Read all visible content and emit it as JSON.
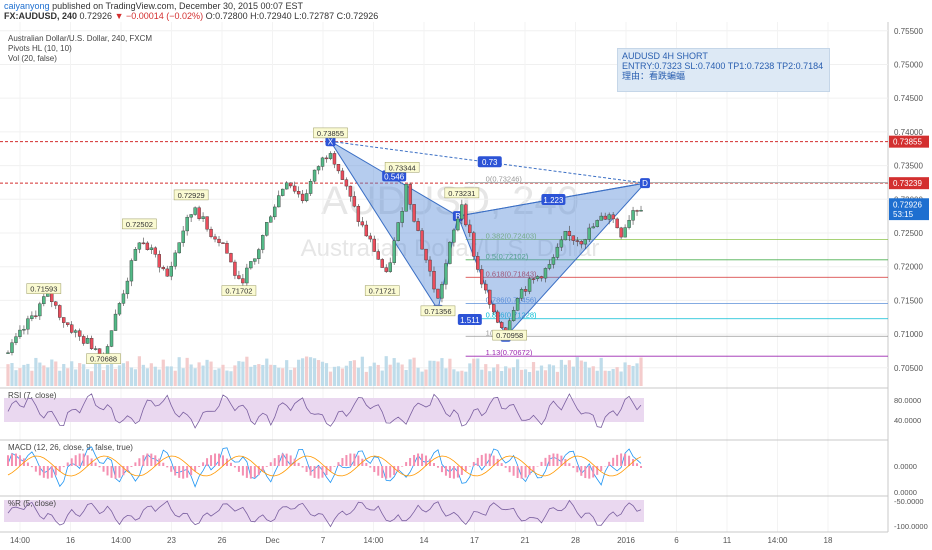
{
  "header": {
    "username": "caiyanyong",
    "published": "published on TradingView.com, December 30, 2015 00:07 EST",
    "symbol": "FX:AUDUSD, 240",
    "price": "0.72926",
    "change": "▼ −0.00014 (−0.02%)",
    "ohlc": "O:0.72800 H:0.72940 L:0.72787 C:0.72926"
  },
  "legend": {
    "title": "Australian Dollar/U.S. Dollar, 240, FXCM",
    "pivots": "Pivots HL (10, 10)",
    "vol": "Vol (20, false)"
  },
  "watermark": {
    "line1": "AUDUSD, 240",
    "line2": "Australian Dollar/U.S. Dollar"
  },
  "trade_box": {
    "line1": "AUDUSD 4H SHORT",
    "line2": "ENTRY:0.7323  SL:0.7400 TP1:0.7238 TP2:0.7184",
    "line3": "理由：看跌蝙蝠"
  },
  "panels": {
    "rsi": {
      "label": "RSI (7, close)",
      "ticks": [
        "80.0000",
        "40.0000"
      ]
    },
    "macd": {
      "label": "MACD (12, 26, close, 9, false, true)",
      "ticks": [
        "0.0000"
      ]
    },
    "wr": {
      "label": "%R (5, close)",
      "ticks": [
        "0.0000",
        "-50.0000",
        "-100.0000"
      ]
    }
  },
  "chart_data": {
    "type": "candlestick",
    "yticks": [
      "0.75500",
      "0.75000",
      "0.74500",
      "0.74000",
      "0.73500",
      "0.73000",
      "0.72500",
      "0.72000",
      "0.71500",
      "0.71000",
      "0.70500"
    ],
    "ytick_values": [
      0.755,
      0.75,
      0.745,
      0.74,
      0.735,
      0.73,
      0.725,
      0.72,
      0.715,
      0.71,
      0.705
    ],
    "ylim": [
      0.7023,
      0.7563
    ],
    "xticks": [
      "14:00",
      "16",
      "14:00",
      "23",
      "26",
      "Dec",
      "7",
      "14:00",
      "14",
      "17",
      "21",
      "28",
      "2016",
      "6",
      "11",
      "14:00",
      "18"
    ],
    "price_tags": [
      {
        "text": "0.73855",
        "value": 0.73855,
        "color": "#d32f2f"
      },
      {
        "text": "0.73239",
        "value": 0.73239,
        "color": "#d32f2f"
      },
      {
        "text": "0.72926",
        "value": 0.72926,
        "color": "#1e6fd0"
      },
      {
        "text": "53:15",
        "value": 0.7278,
        "color": "#1e6fd0"
      }
    ],
    "hlines": [
      {
        "value": 0.73855,
        "color": "#d32f2f",
        "dash": true
      },
      {
        "value": 0.73239,
        "color": "#d32f2f",
        "dash": true
      }
    ],
    "pivots": [
      {
        "text": "0.71593",
        "i": 9,
        "value": 0.7166
      },
      {
        "text": "0.70688",
        "i": 24,
        "value": 0.7062
      },
      {
        "text": "0.72502",
        "i": 33,
        "value": 0.7262
      },
      {
        "text": "0.72929",
        "i": 46,
        "value": 0.7305
      },
      {
        "text": "0.71702",
        "i": 58,
        "value": 0.7163
      },
      {
        "text": "0.73855",
        "i": 81,
        "value": 0.7397
      },
      {
        "text": "0.73344",
        "i": 99,
        "value": 0.7346
      },
      {
        "text": "0.71721",
        "i": 94,
        "value": 0.7163
      },
      {
        "text": "0.71356",
        "i": 108,
        "value": 0.7133
      },
      {
        "text": "0.73231",
        "i": 114,
        "value": 0.7308
      },
      {
        "text": "0.70958",
        "i": 126,
        "value": 0.7097
      }
    ],
    "pattern": {
      "points": [
        {
          "label": "X",
          "i": 81,
          "value": 0.7386
        },
        {
          "label": "A",
          "i": 108,
          "value": 0.7136
        },
        {
          "label": "B",
          "i": 113,
          "value": 0.7275
        },
        {
          "label": "C",
          "i": 125,
          "value": 0.7096
        },
        {
          "label": "D",
          "i": 160,
          "value": 0.7324
        }
      ],
      "ratios": [
        {
          "text": "0.546",
          "i": 97,
          "value": 0.7334
        },
        {
          "text": "1.511",
          "i": 116,
          "value": 0.7121
        },
        {
          "text": "1.223",
          "i": 137,
          "value": 0.7299
        },
        {
          "text": "0.73",
          "i": 121,
          "value": 0.7355
        }
      ]
    },
    "fib_levels": [
      {
        "text": "0(0.73246)",
        "value": 0.73246,
        "color": "#999999"
      },
      {
        "text": "0.382(0.72403)",
        "value": 0.72403,
        "color": "#8bc34a"
      },
      {
        "text": "0.5(0.72102)",
        "value": 0.72102,
        "color": "#4caf50"
      },
      {
        "text": "0.618(0.71843)",
        "value": 0.71843,
        "color": "#d32f2f"
      },
      {
        "text": "0.786(0.71456)",
        "value": 0.71456,
        "color": "#5b8fd9"
      },
      {
        "text": "0.886(0.71228)",
        "value": 0.71228,
        "color": "#00bcd4"
      },
      {
        "text": "1(0.70968)",
        "value": 0.70968,
        "color": "#999999"
      },
      {
        "text": "1.13(0.70672)",
        "value": 0.70672,
        "color": "#9c27b0"
      }
    ],
    "candles_count": 160,
    "close_path": [
      [
        0,
        0.7072
      ],
      [
        6,
        0.7125
      ],
      [
        10,
        0.716
      ],
      [
        14,
        0.712
      ],
      [
        18,
        0.7095
      ],
      [
        22,
        0.708
      ],
      [
        24,
        0.7069
      ],
      [
        28,
        0.7145
      ],
      [
        33,
        0.724
      ],
      [
        37,
        0.7215
      ],
      [
        40,
        0.7185
      ],
      [
        44,
        0.7255
      ],
      [
        47,
        0.729
      ],
      [
        50,
        0.7255
      ],
      [
        54,
        0.7235
      ],
      [
        58,
        0.7175
      ],
      [
        62,
        0.721
      ],
      [
        66,
        0.728
      ],
      [
        70,
        0.733
      ],
      [
        74,
        0.73
      ],
      [
        78,
        0.735
      ],
      [
        81,
        0.7375
      ],
      [
        84,
        0.733
      ],
      [
        88,
        0.727
      ],
      [
        92,
        0.7225
      ],
      [
        95,
        0.7185
      ],
      [
        98,
        0.726
      ],
      [
        100,
        0.732
      ],
      [
        104,
        0.723
      ],
      [
        108,
        0.715
      ],
      [
        111,
        0.723
      ],
      [
        114,
        0.7295
      ],
      [
        118,
        0.7195
      ],
      [
        122,
        0.7125
      ],
      [
        125,
        0.7105
      ],
      [
        128,
        0.716
      ],
      [
        132,
        0.718
      ],
      [
        136,
        0.72
      ],
      [
        140,
        0.7245
      ],
      [
        144,
        0.724
      ],
      [
        148,
        0.7265
      ],
      [
        151,
        0.728
      ],
      [
        154,
        0.725
      ],
      [
        157,
        0.7285
      ],
      [
        160,
        0.7293
      ]
    ]
  }
}
